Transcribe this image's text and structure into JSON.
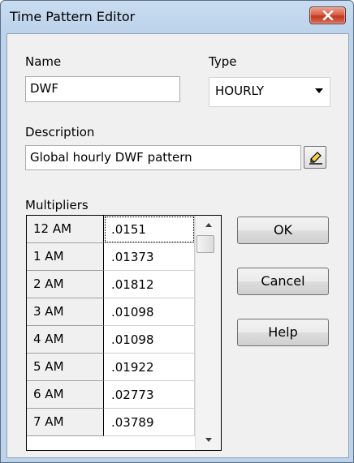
{
  "window": {
    "title": "Time Pattern Editor"
  },
  "name": {
    "label": "Name",
    "value": "DWF"
  },
  "type": {
    "label": "Type",
    "value": "HOURLY"
  },
  "description": {
    "label": "Description",
    "value": "Global hourly DWF pattern"
  },
  "multipliers": {
    "label": "Multipliers",
    "rows": [
      {
        "time": "12 AM",
        "value": ".0151"
      },
      {
        "time": "1 AM",
        "value": ".01373"
      },
      {
        "time": "2 AM",
        "value": ".01812"
      },
      {
        "time": "3 AM",
        "value": ".01098"
      },
      {
        "time": "4 AM",
        "value": ".01098"
      },
      {
        "time": "5 AM",
        "value": ".01922"
      },
      {
        "time": "6 AM",
        "value": ".02773"
      },
      {
        "time": "7 AM",
        "value": ".03789"
      }
    ]
  },
  "buttons": {
    "ok": "OK",
    "cancel": "Cancel",
    "help": "Help"
  },
  "icons": {
    "close": "close-icon",
    "browse": "edit-pencil-icon"
  }
}
